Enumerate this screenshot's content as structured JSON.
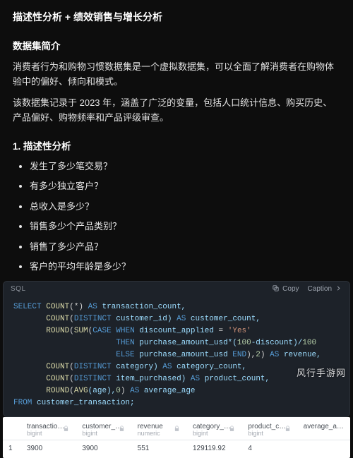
{
  "title": "描述性分析 + 绩效销售与增长分析",
  "intro": {
    "heading": "数据集简介",
    "p1": "消费者行为和购物习惯数据集是一个虚拟数据集，可以全面了解消费者在购物体验中的偏好、倾向和模式。",
    "p2": "该数据集记录于 2023 年，涵盖了广泛的变量，包括人口统计信息、购买历史、产品偏好、购物频率和产品评级审查。"
  },
  "section1": {
    "heading": "1. 描述性分析",
    "questions": [
      "发生了多少笔交易？",
      "有多少独立客户？",
      "总收入是多少？",
      "销售多少个产品类别？",
      "销售了多少产品？",
      "客户的平均年龄是多少？"
    ]
  },
  "code": {
    "lang": "SQL",
    "copy_label": "Copy",
    "caption_label": "Caption",
    "lines": {
      "l1a": "SELECT",
      "l1b": "COUNT",
      "l1c": "(*)",
      "l1d": "AS",
      "l1e": "transaction_count,",
      "l2a": "COUNT",
      "l2b": "(",
      "l2c": "DISTINCT",
      "l2d": "customer_id)",
      "l2e": "AS",
      "l2f": "customer_count,",
      "l3a": "ROUND",
      "l3b": "(",
      "l3c": "SUM",
      "l3d": "(",
      "l3e": "CASE WHEN",
      "l3f": "discount_applied",
      "l3g": "=",
      "l3h": "'Yes'",
      "l4a": "THEN",
      "l4b": "purchase_amount_usd*(",
      "l4c": "100",
      "l4d": "-discount)/",
      "l4e": "100",
      "l5a": "ELSE",
      "l5b": "purchase_amount_usd",
      "l5c": "END",
      "l5d": "),",
      "l5e": "2",
      "l5f": ")",
      "l5g": "AS",
      "l5h": "revenue,",
      "l6a": "COUNT",
      "l6b": "(",
      "l6c": "DISTINCT",
      "l6d": "category)",
      "l6e": "AS",
      "l6f": "category_count,",
      "l7a": "COUNT",
      "l7b": "(",
      "l7c": "DISTINCT",
      "l7d": "item_purchased)",
      "l7e": "AS",
      "l7f": "product_count,",
      "l8a": "ROUND",
      "l8b": "(",
      "l8c": "AVG",
      "l8d": "(age),",
      "l8e": "0",
      "l8f": ")",
      "l8g": "AS",
      "l8h": "average_age",
      "l9a": "FROM",
      "l9b": "customer_transaction;"
    }
  },
  "result": {
    "columns": [
      {
        "name": "transaction_count",
        "type": "bigint"
      },
      {
        "name": "customer_count",
        "type": "bigint"
      },
      {
        "name": "revenue",
        "type": "numeric"
      },
      {
        "name": "category_count",
        "type": "bigint"
      },
      {
        "name": "product_count",
        "type": "bigint"
      },
      {
        "name": "average_age",
        "type": ""
      }
    ],
    "row_index": "1",
    "row": [
      "3900",
      "3900",
      "551",
      "129119.92",
      "4",
      ""
    ]
  },
  "watermark": "风行手游网"
}
